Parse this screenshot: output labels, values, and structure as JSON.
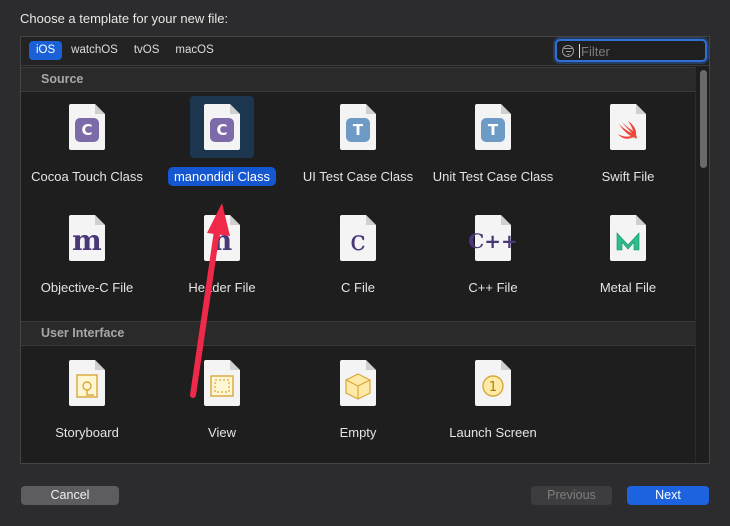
{
  "dialog": {
    "heading": "Choose a template for your new file:"
  },
  "tabs": [
    {
      "label": "iOS",
      "active": true
    },
    {
      "label": "watchOS",
      "active": false
    },
    {
      "label": "tvOS",
      "active": false
    },
    {
      "label": "macOS",
      "active": false
    }
  ],
  "filter": {
    "placeholder": "Filter",
    "value": ""
  },
  "sections": [
    {
      "title": "Source",
      "items": [
        {
          "label": "Cocoa Touch Class",
          "icon": "swift-class-icon"
        },
        {
          "label": "manondidi Class",
          "icon": "swift-class-icon",
          "selected": true
        },
        {
          "label": "UI Test Case Class",
          "icon": "test-case-icon"
        },
        {
          "label": "Unit Test Case Class",
          "icon": "test-case-icon"
        },
        {
          "label": "Swift File",
          "icon": "swift-icon"
        },
        {
          "label": "Objective-C File",
          "icon": "objc-file-icon"
        },
        {
          "label": "Header File",
          "icon": "header-file-icon"
        },
        {
          "label": "C File",
          "icon": "c-file-icon"
        },
        {
          "label": "C++ File",
          "icon": "cpp-file-icon"
        },
        {
          "label": "Metal File",
          "icon": "metal-file-icon"
        }
      ]
    },
    {
      "title": "User Interface",
      "items": [
        {
          "label": "Storyboard",
          "icon": "storyboard-icon"
        },
        {
          "label": "View",
          "icon": "view-icon"
        },
        {
          "label": "Empty",
          "icon": "empty-icon"
        },
        {
          "label": "Launch Screen",
          "icon": "launch-screen-icon"
        }
      ]
    }
  ],
  "glyphs": {
    "c": "C",
    "t": "T",
    "m": "m",
    "h": "h",
    "c_serif": "c",
    "cpp": "C++",
    "launch": "1"
  },
  "buttons": {
    "cancel": "Cancel",
    "previous": "Previous",
    "next": "Next"
  },
  "colors": {
    "accent": "#1d63e0",
    "annotation_arrow": "#f0284a"
  }
}
